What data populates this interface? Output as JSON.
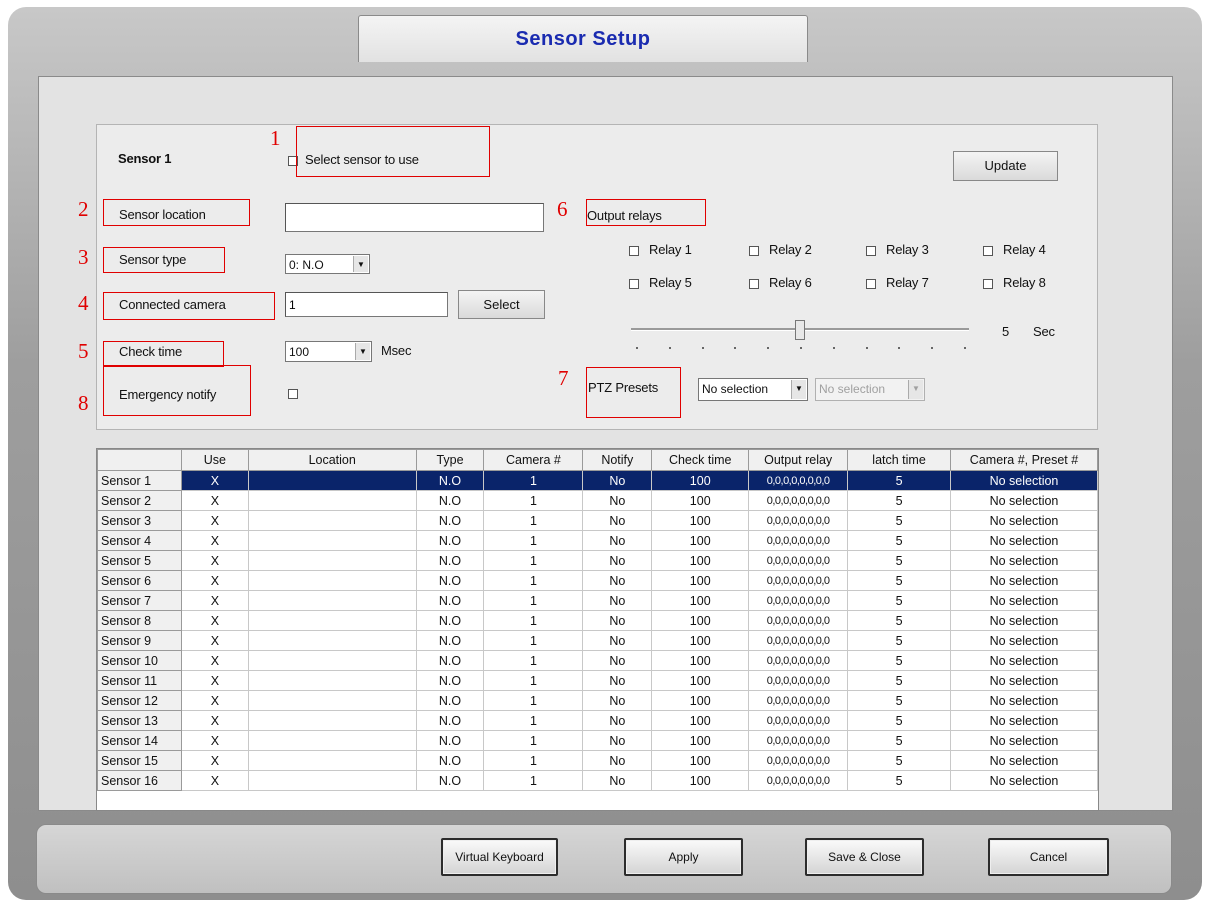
{
  "window": {
    "title": "Sensor Setup"
  },
  "sensor_panel": {
    "sensor_name": "Sensor 1",
    "select_label": "Select sensor to use",
    "update_label": "Update",
    "location_label": "Sensor location",
    "location_value": "",
    "type_label": "Sensor type",
    "type_value": "0: N.O",
    "camera_label": "Connected camera",
    "camera_value": "1",
    "camera_select_label": "Select",
    "check_time_label": "Check time",
    "check_time_value": "100",
    "check_time_unit": "Msec",
    "emergency_label": "Emergency notify",
    "output_relays_label": "Output relays",
    "relays": [
      "Relay 1",
      "Relay 2",
      "Relay 3",
      "Relay 4",
      "Relay 5",
      "Relay 6",
      "Relay 7",
      "Relay 8"
    ],
    "latch_value": "5",
    "latch_unit": "Sec",
    "latch_slider_value": 5,
    "latch_slider_range": [
      0,
      10
    ],
    "ptz_label": "PTZ Presets",
    "ptz_camera_value": "No selection",
    "ptz_preset_value": "No selection"
  },
  "annotations": [
    "1",
    "2",
    "3",
    "4",
    "5",
    "6",
    "7",
    "8"
  ],
  "table": {
    "columns": [
      "",
      "Use",
      "Location",
      "Type",
      "Camera #",
      "Notify",
      "Check time",
      "Output relay",
      "latch time",
      "Camera #, Preset #"
    ],
    "selected_row": 0,
    "rows": [
      [
        "Sensor 1",
        "X",
        "",
        "N.O",
        "1",
        "No",
        "100",
        "0,0,0,0,0,0,0,0",
        "5",
        "No selection"
      ],
      [
        "Sensor 2",
        "X",
        "",
        "N.O",
        "1",
        "No",
        "100",
        "0,0,0,0,0,0,0,0",
        "5",
        "No selection"
      ],
      [
        "Sensor 3",
        "X",
        "",
        "N.O",
        "1",
        "No",
        "100",
        "0,0,0,0,0,0,0,0",
        "5",
        "No selection"
      ],
      [
        "Sensor 4",
        "X",
        "",
        "N.O",
        "1",
        "No",
        "100",
        "0,0,0,0,0,0,0,0",
        "5",
        "No selection"
      ],
      [
        "Sensor 5",
        "X",
        "",
        "N.O",
        "1",
        "No",
        "100",
        "0,0,0,0,0,0,0,0",
        "5",
        "No selection"
      ],
      [
        "Sensor 6",
        "X",
        "",
        "N.O",
        "1",
        "No",
        "100",
        "0,0,0,0,0,0,0,0",
        "5",
        "No selection"
      ],
      [
        "Sensor 7",
        "X",
        "",
        "N.O",
        "1",
        "No",
        "100",
        "0,0,0,0,0,0,0,0",
        "5",
        "No selection"
      ],
      [
        "Sensor 8",
        "X",
        "",
        "N.O",
        "1",
        "No",
        "100",
        "0,0,0,0,0,0,0,0",
        "5",
        "No selection"
      ],
      [
        "Sensor 9",
        "X",
        "",
        "N.O",
        "1",
        "No",
        "100",
        "0,0,0,0,0,0,0,0",
        "5",
        "No selection"
      ],
      [
        "Sensor 10",
        "X",
        "",
        "N.O",
        "1",
        "No",
        "100",
        "0,0,0,0,0,0,0,0",
        "5",
        "No selection"
      ],
      [
        "Sensor 11",
        "X",
        "",
        "N.O",
        "1",
        "No",
        "100",
        "0,0,0,0,0,0,0,0",
        "5",
        "No selection"
      ],
      [
        "Sensor 12",
        "X",
        "",
        "N.O",
        "1",
        "No",
        "100",
        "0,0,0,0,0,0,0,0",
        "5",
        "No selection"
      ],
      [
        "Sensor 13",
        "X",
        "",
        "N.O",
        "1",
        "No",
        "100",
        "0,0,0,0,0,0,0,0",
        "5",
        "No selection"
      ],
      [
        "Sensor 14",
        "X",
        "",
        "N.O",
        "1",
        "No",
        "100",
        "0,0,0,0,0,0,0,0",
        "5",
        "No selection"
      ],
      [
        "Sensor 15",
        "X",
        "",
        "N.O",
        "1",
        "No",
        "100",
        "0,0,0,0,0,0,0,0",
        "5",
        "No selection"
      ],
      [
        "Sensor 16",
        "X",
        "",
        "N.O",
        "1",
        "No",
        "100",
        "0,0,0,0,0,0,0,0",
        "5",
        "No selection"
      ]
    ]
  },
  "footer": {
    "virtual_keyboard_label": "Virtual Keyboard",
    "apply_label": "Apply",
    "save_close_label": "Save & Close",
    "cancel_label": "Cancel"
  },
  "colors": {
    "title": "#1a2bb0",
    "annotation": "#e00000",
    "selection": "#0a246a"
  }
}
